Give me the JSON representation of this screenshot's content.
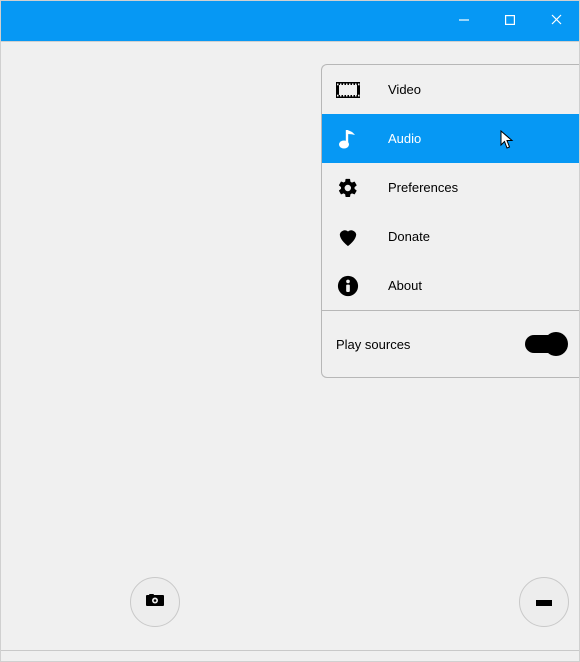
{
  "menu": {
    "items": [
      {
        "label": "Video"
      },
      {
        "label": "Audio"
      },
      {
        "label": "Preferences"
      },
      {
        "label": "Donate"
      },
      {
        "label": "About"
      }
    ],
    "toggle_label": "Play sources",
    "toggle_on": true
  },
  "colors": {
    "accent": "#0698f4"
  }
}
